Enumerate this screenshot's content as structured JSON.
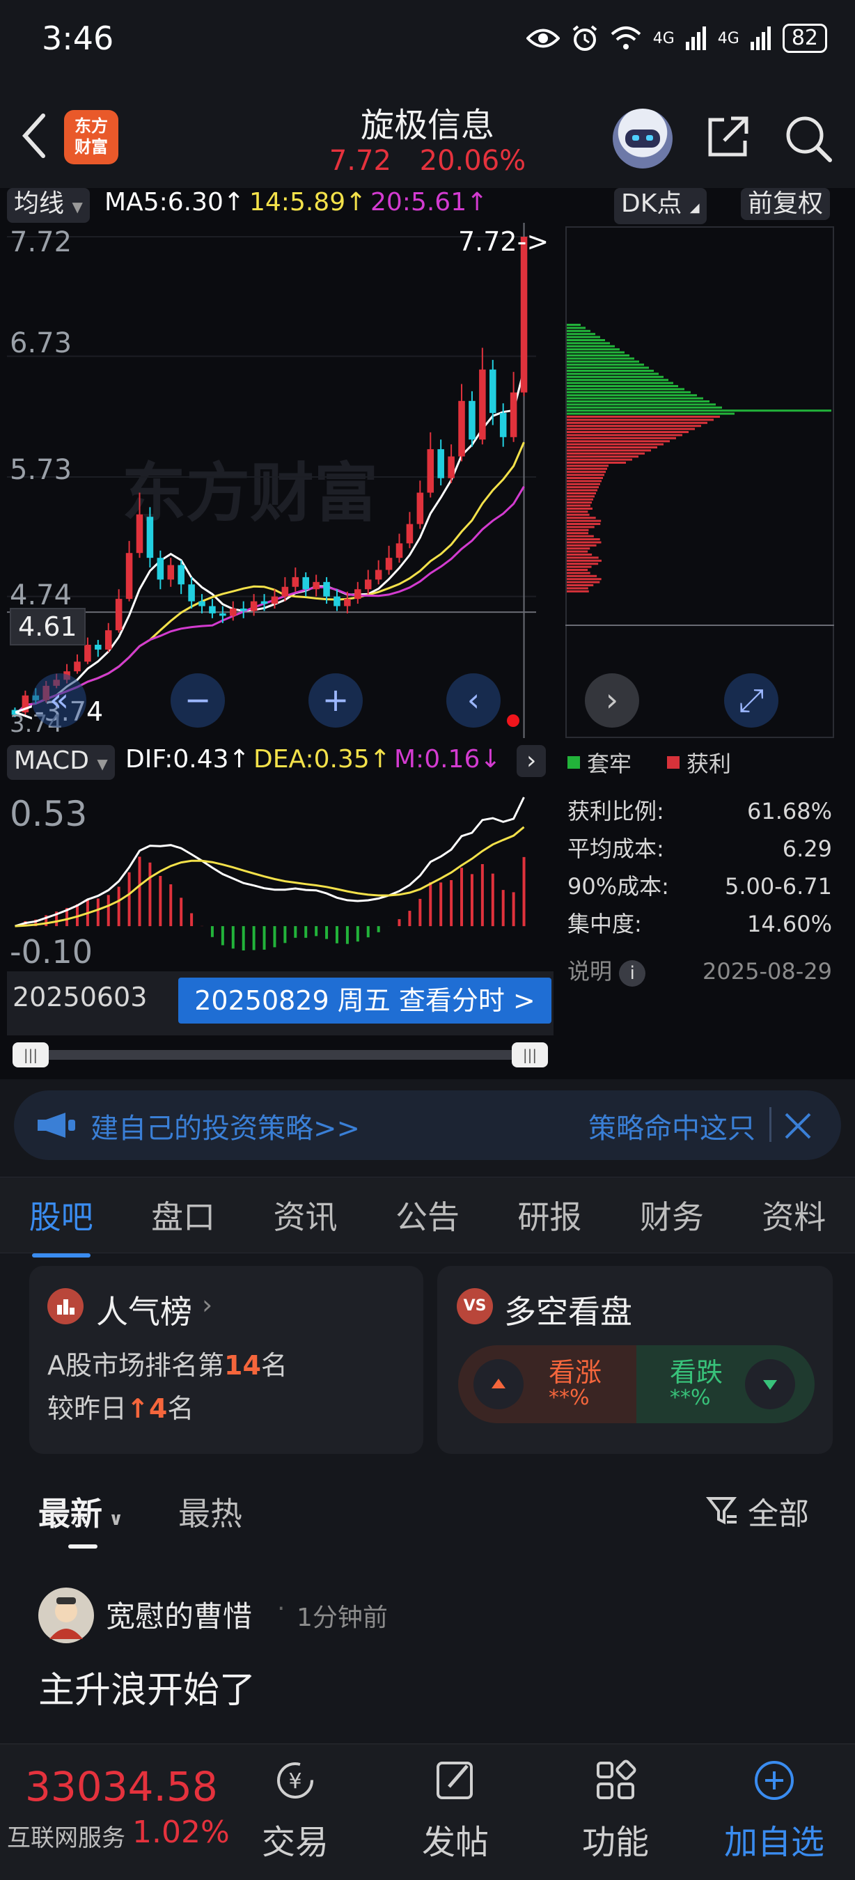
{
  "status_bar": {
    "time": "3:46",
    "network": "4G",
    "battery": "82"
  },
  "header": {
    "logo_text_1": "东方",
    "logo_text_2": "财富",
    "title": "旋极信息",
    "price": "7.72",
    "change_pct": "20.06%"
  },
  "ma_bar": {
    "type_label": "均线",
    "ma5": "MA5:6.30↑",
    "ma14": "14:5.89↑",
    "ma20": "20:5.61↑",
    "dk_label": "DK点",
    "adjust_label": "前复权"
  },
  "kline": {
    "y_ticks": [
      "7.72",
      "6.73",
      "5.73",
      "4.74"
    ],
    "last_price_marker": "7.72->",
    "cursor_price": "4.61",
    "low_marker": "<-3.74",
    "low_tick": "3.74",
    "watermark": "东方财富",
    "candles": [
      {
        "o": 3.8,
        "c": 3.76,
        "h": 3.82,
        "l": 3.74
      },
      {
        "o": 3.78,
        "c": 3.92,
        "h": 3.96,
        "l": 3.76
      },
      {
        "o": 3.92,
        "c": 3.88,
        "h": 3.98,
        "l": 3.85
      },
      {
        "o": 3.88,
        "c": 4.0,
        "h": 4.04,
        "l": 3.86
      },
      {
        "o": 4.0,
        "c": 4.05,
        "h": 4.1,
        "l": 3.98
      },
      {
        "o": 4.05,
        "c": 4.12,
        "h": 4.18,
        "l": 4.02
      },
      {
        "o": 4.12,
        "c": 4.2,
        "h": 4.26,
        "l": 4.1
      },
      {
        "o": 4.2,
        "c": 4.34,
        "h": 4.4,
        "l": 4.18
      },
      {
        "o": 4.34,
        "c": 4.3,
        "h": 4.38,
        "l": 4.24
      },
      {
        "o": 4.3,
        "c": 4.46,
        "h": 4.52,
        "l": 4.28
      },
      {
        "o": 4.46,
        "c": 4.72,
        "h": 4.8,
        "l": 4.44
      },
      {
        "o": 4.72,
        "c": 5.1,
        "h": 5.2,
        "l": 4.7
      },
      {
        "o": 5.1,
        "c": 5.42,
        "h": 5.6,
        "l": 5.06
      },
      {
        "o": 5.4,
        "c": 5.06,
        "h": 5.48,
        "l": 4.98
      },
      {
        "o": 5.06,
        "c": 4.88,
        "h": 5.12,
        "l": 4.8
      },
      {
        "o": 4.88,
        "c": 5.0,
        "h": 5.06,
        "l": 4.82
      },
      {
        "o": 5.0,
        "c": 4.84,
        "h": 5.04,
        "l": 4.76
      },
      {
        "o": 4.84,
        "c": 4.7,
        "h": 4.9,
        "l": 4.64
      },
      {
        "o": 4.7,
        "c": 4.66,
        "h": 4.76,
        "l": 4.6
      },
      {
        "o": 4.66,
        "c": 4.6,
        "h": 4.72,
        "l": 4.56
      },
      {
        "o": 4.6,
        "c": 4.58,
        "h": 4.66,
        "l": 4.52
      },
      {
        "o": 4.58,
        "c": 4.64,
        "h": 4.7,
        "l": 4.54
      },
      {
        "o": 4.64,
        "c": 4.62,
        "h": 4.7,
        "l": 4.56
      },
      {
        "o": 4.62,
        "c": 4.7,
        "h": 4.76,
        "l": 4.58
      },
      {
        "o": 4.7,
        "c": 4.68,
        "h": 4.76,
        "l": 4.62
      },
      {
        "o": 4.68,
        "c": 4.74,
        "h": 4.8,
        "l": 4.64
      },
      {
        "o": 4.74,
        "c": 4.82,
        "h": 4.9,
        "l": 4.7
      },
      {
        "o": 4.82,
        "c": 4.9,
        "h": 4.98,
        "l": 4.78
      },
      {
        "o": 4.9,
        "c": 4.8,
        "h": 4.94,
        "l": 4.74
      },
      {
        "o": 4.8,
        "c": 4.86,
        "h": 4.92,
        "l": 4.74
      },
      {
        "o": 4.86,
        "c": 4.74,
        "h": 4.9,
        "l": 4.68
      },
      {
        "o": 4.74,
        "c": 4.66,
        "h": 4.8,
        "l": 4.62
      },
      {
        "o": 4.66,
        "c": 4.72,
        "h": 4.78,
        "l": 4.6
      },
      {
        "o": 4.72,
        "c": 4.8,
        "h": 4.86,
        "l": 4.68
      },
      {
        "o": 4.8,
        "c": 4.88,
        "h": 4.96,
        "l": 4.76
      },
      {
        "o": 4.88,
        "c": 4.96,
        "h": 5.04,
        "l": 4.84
      },
      {
        "o": 4.96,
        "c": 5.06,
        "h": 5.16,
        "l": 4.92
      },
      {
        "o": 5.06,
        "c": 5.18,
        "h": 5.26,
        "l": 5.02
      },
      {
        "o": 5.18,
        "c": 5.34,
        "h": 5.44,
        "l": 5.14
      },
      {
        "o": 5.34,
        "c": 5.6,
        "h": 5.7,
        "l": 5.3
      },
      {
        "o": 5.6,
        "c": 5.96,
        "h": 6.1,
        "l": 5.56
      },
      {
        "o": 5.96,
        "c": 5.72,
        "h": 6.04,
        "l": 5.66
      },
      {
        "o": 5.72,
        "c": 5.9,
        "h": 6.0,
        "l": 5.68
      },
      {
        "o": 5.9,
        "c": 6.36,
        "h": 6.5,
        "l": 5.86
      },
      {
        "o": 6.36,
        "c": 6.04,
        "h": 6.44,
        "l": 5.98
      },
      {
        "o": 6.04,
        "c": 6.62,
        "h": 6.8,
        "l": 6.0
      },
      {
        "o": 6.62,
        "c": 6.26,
        "h": 6.7,
        "l": 6.16
      },
      {
        "o": 6.26,
        "c": 6.06,
        "h": 6.34,
        "l": 5.98
      },
      {
        "o": 6.06,
        "c": 6.43,
        "h": 6.6,
        "l": 6.02
      },
      {
        "o": 6.43,
        "c": 7.72,
        "h": 7.72,
        "l": 6.4
      }
    ]
  },
  "chip": {
    "legend_trapped": "套牢",
    "legend_profit": "获利",
    "rows": [
      {
        "label": "获利比例:",
        "value": "61.68%"
      },
      {
        "label": "平均成本:",
        "value": "6.29"
      },
      {
        "label": "90%成本:",
        "value": "5.00-6.71"
      },
      {
        "label": "集中度:",
        "value": "14.60%"
      }
    ],
    "note_label": "说明",
    "date": "2025-08-29"
  },
  "macd": {
    "type_label": "MACD",
    "dif": "DIF:0.43↑",
    "dea": "DEA:0.35↑",
    "m": "M:0.16↓",
    "y_top": "0.53",
    "y_bottom": "-0.10"
  },
  "dates": {
    "start": "20250603",
    "end_button": "20250829 周五 查看分时 >"
  },
  "banner": {
    "text": "建自己的投资策略>>",
    "text2": "策略命中这只"
  },
  "tabs": [
    "股吧",
    "盘口",
    "资讯",
    "公告",
    "研报",
    "财务",
    "资料"
  ],
  "popularity": {
    "title": "人气榜",
    "line1_pre": "A股市场排名第",
    "rank": "14",
    "line1_post": "名",
    "line2_pre": "较昨日",
    "change": "4",
    "line2_post": "名"
  },
  "sentiment": {
    "title": "多空看盘",
    "bull_label": "看涨",
    "bull_value": "**%",
    "bear_label": "看跌",
    "bear_value": "**%"
  },
  "filter": {
    "latest": "最新",
    "hot": "最热",
    "all": "全部"
  },
  "post": {
    "author": "宽慰的曹惜",
    "time": "1分钟前",
    "content": "主升浪开始了"
  },
  "bottom": {
    "index_value": "33034.58",
    "index_name": "互联网服务",
    "index_pct": "1.02%",
    "nav": [
      "交易",
      "发帖",
      "功能",
      "加自选"
    ]
  }
}
